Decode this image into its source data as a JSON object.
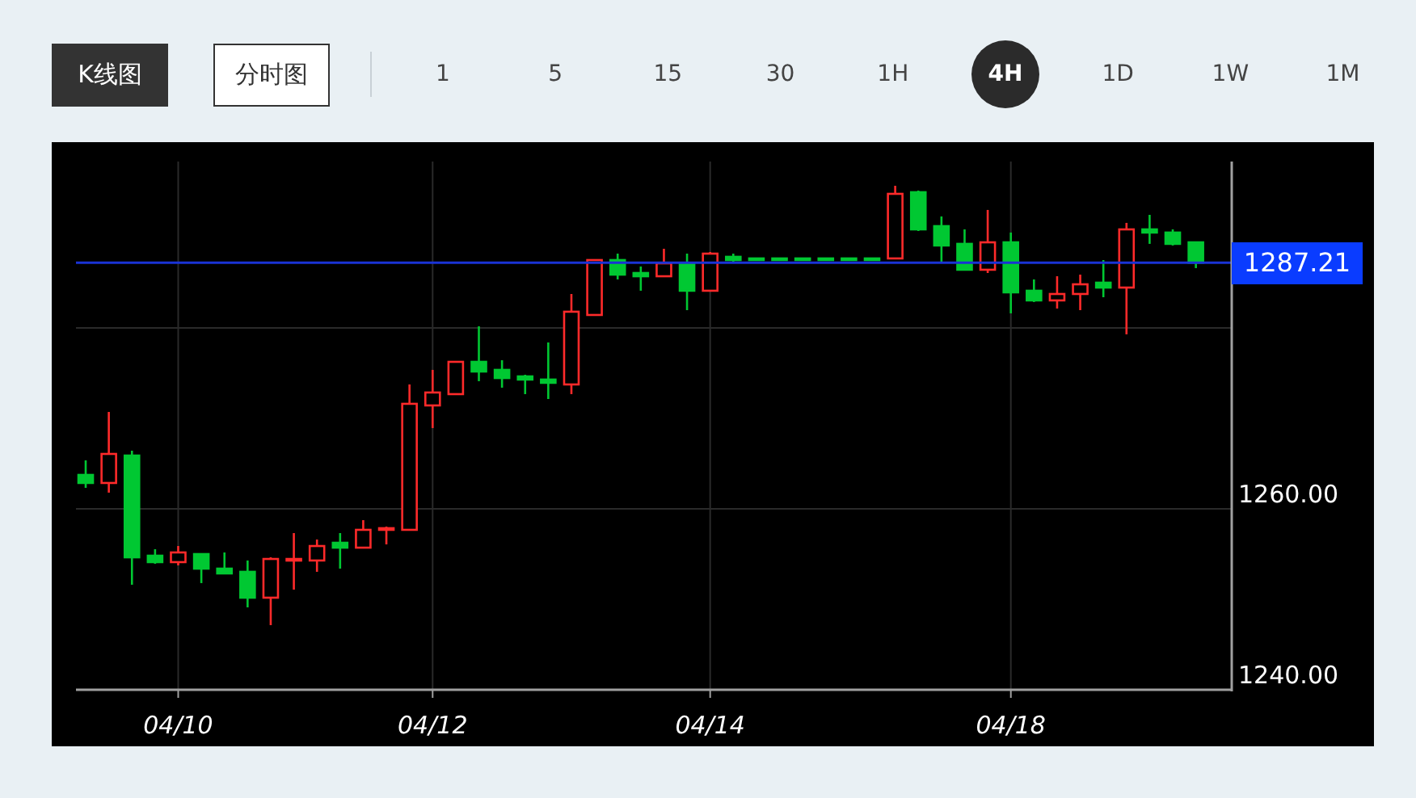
{
  "chart_types": [
    {
      "label": "K线图",
      "selected": true
    },
    {
      "label": "分时图",
      "selected": false
    }
  ],
  "intervals": [
    {
      "label": "1",
      "selected": false
    },
    {
      "label": "5",
      "selected": false
    },
    {
      "label": "15",
      "selected": false
    },
    {
      "label": "30",
      "selected": false
    },
    {
      "label": "1H",
      "selected": false
    },
    {
      "label": "4H",
      "selected": true
    },
    {
      "label": "1D",
      "selected": false
    },
    {
      "label": "1W",
      "selected": false
    },
    {
      "label": "1M",
      "selected": false
    }
  ],
  "chart": {
    "chart_data": {
      "type": "candlestick",
      "grid": true,
      "ref_lines": [
        {
          "axis": "y",
          "value": 1287.21,
          "label": "1287.21"
        }
      ],
      "categories": [
        null,
        null,
        null,
        null,
        "04/10",
        null,
        null,
        null,
        null,
        null,
        null,
        null,
        null,
        null,
        null,
        "04/12",
        null,
        null,
        null,
        null,
        null,
        null,
        null,
        null,
        null,
        null,
        null,
        "04/14",
        null,
        null,
        null,
        null,
        null,
        null,
        null,
        null,
        null,
        null,
        null,
        null,
        "04/18",
        null,
        null,
        null,
        null,
        null,
        null,
        null,
        null
      ],
      "ohlc": [
        [
          1263.75,
          1265.36,
          1262.32,
          1262.86
        ],
        [
          1262.86,
          1270.71,
          1261.79,
          1266.07
        ],
        [
          1265.89,
          1266.43,
          1251.61,
          1254.64
        ],
        [
          1254.82,
          1255.54,
          1253.93,
          1254.11
        ],
        [
          1254.11,
          1255.89,
          1253.75,
          1255.18
        ],
        [
          1255.0,
          1255.0,
          1251.79,
          1253.39
        ],
        [
          1253.39,
          1255.18,
          1252.86,
          1252.86
        ],
        [
          1253.04,
          1254.29,
          1249.11,
          1250.18
        ],
        [
          1250.18,
          1254.64,
          1247.14,
          1254.46
        ],
        [
          1254.29,
          1257.32,
          1251.07,
          1254.46
        ],
        [
          1254.29,
          1256.61,
          1253.04,
          1255.89
        ],
        [
          1256.25,
          1257.32,
          1253.39,
          1255.71
        ],
        [
          1255.71,
          1258.75,
          1255.71,
          1257.68
        ],
        [
          1257.68,
          1258.04,
          1256.07,
          1257.86
        ],
        [
          1257.68,
          1273.75,
          1257.68,
          1271.61
        ],
        [
          1271.43,
          1275.36,
          1268.93,
          1272.86
        ],
        [
          1272.68,
          1276.25,
          1272.68,
          1276.25
        ],
        [
          1276.25,
          1280.18,
          1274.11,
          1275.18
        ],
        [
          1275.36,
          1276.43,
          1273.39,
          1274.46
        ],
        [
          1274.64,
          1274.82,
          1272.68,
          1274.29
        ],
        [
          1274.29,
          1278.39,
          1272.14,
          1273.93
        ],
        [
          1273.75,
          1283.75,
          1272.68,
          1281.79
        ],
        [
          1281.43,
          1287.5,
          1281.43,
          1287.5
        ],
        [
          1287.5,
          1288.21,
          1285.36,
          1285.89
        ],
        [
          1286.07,
          1286.79,
          1284.11,
          1285.71
        ],
        [
          1285.71,
          1288.75,
          1285.71,
          1287.14
        ],
        [
          1287.14,
          1288.21,
          1281.96,
          1284.11
        ],
        [
          1284.11,
          1288.39,
          1284.11,
          1288.21
        ],
        [
          1287.86,
          1288.21,
          1287.32,
          1287.5
        ],
        [
          1287.68,
          1287.68,
          1287.5,
          1287.5
        ],
        [
          1287.68,
          1287.68,
          1287.5,
          1287.5
        ],
        [
          1287.68,
          1287.68,
          1287.5,
          1287.5
        ],
        [
          1287.68,
          1287.68,
          1287.5,
          1287.5
        ],
        [
          1287.68,
          1287.68,
          1287.5,
          1287.5
        ],
        [
          1287.68,
          1287.68,
          1287.5,
          1287.5
        ],
        [
          1287.68,
          1295.71,
          1287.68,
          1294.82
        ],
        [
          1295.0,
          1295.18,
          1290.71,
          1290.89
        ],
        [
          1291.25,
          1292.32,
          1287.32,
          1289.11
        ],
        [
          1289.29,
          1290.89,
          1286.43,
          1286.43
        ],
        [
          1286.43,
          1293.04,
          1286.07,
          1289.46
        ],
        [
          1289.46,
          1290.54,
          1281.61,
          1283.93
        ],
        [
          1284.11,
          1285.36,
          1282.86,
          1283.04
        ],
        [
          1283.04,
          1285.71,
          1282.14,
          1283.75
        ],
        [
          1283.75,
          1285.89,
          1281.96,
          1284.82
        ],
        [
          1285.0,
          1287.5,
          1283.39,
          1284.46
        ],
        [
          1284.46,
          1291.61,
          1279.29,
          1290.89
        ],
        [
          1290.89,
          1292.5,
          1289.29,
          1290.54
        ],
        [
          1290.54,
          1290.89,
          1289.11,
          1289.29
        ],
        [
          1289.46,
          1289.46,
          1286.61,
          1287.21
        ]
      ],
      "ylim": [
        1240,
        1298.39
      ],
      "yticks": [
        {
          "value": 1260,
          "label": "1260.00"
        },
        {
          "value": 1240,
          "label": "1240.00"
        }
      ]
    }
  }
}
